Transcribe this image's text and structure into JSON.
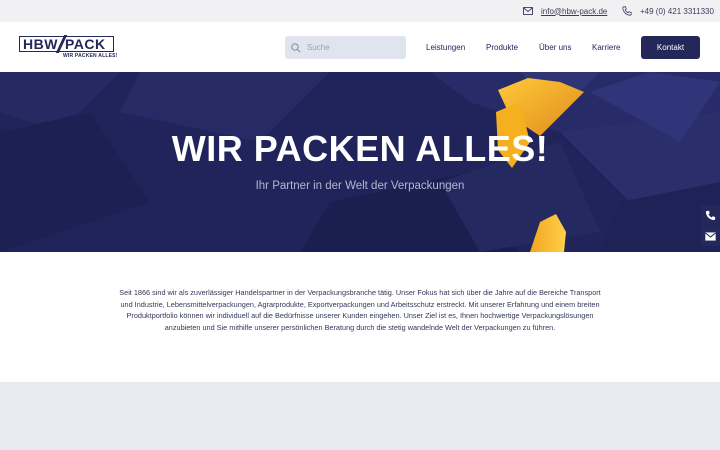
{
  "topbar": {
    "email": "info@hbw-pack.de",
    "phone": "+49 (0) 421 3311330"
  },
  "logo": {
    "brand_left": "HBW",
    "brand_right": "PACK",
    "tagline": "WIR PACKEN ALLES!"
  },
  "search": {
    "placeholder": "Suche"
  },
  "nav": {
    "items": [
      {
        "label": "Leistungen"
      },
      {
        "label": "Produkte"
      },
      {
        "label": "Über uns"
      },
      {
        "label": "Karriere"
      }
    ],
    "cta_label": "Kontakt"
  },
  "hero": {
    "title": "WIR PACKEN ALLES!",
    "subtitle": "Ihr Partner in der Welt der Verpackungen"
  },
  "intro": {
    "text": "Seit 1866 sind wir als zuverlässiger Handelspartner in der Verpackungsbranche tätig. Unser Fokus hat sich über die Jahre auf die Bereiche Transport und Industrie, Lebensmittelverpackungen, Agrarprodukte, Exportverpackungen und Arbeitsschutz erstreckt. Mit unserer Erfahrung und einem breiten Produktportfolio können wir individuell auf die Bedürfnisse unserer Kunden eingehen. Unser Ziel ist es, Ihnen hochwertige Verpackungslösungen anzubieten und Sie mithilfe unserer persönlichen Beratung durch die stetig wandelnde Welt der Verpackungen zu führen."
  },
  "icons": {
    "mail": "mail-icon",
    "phone": "phone-icon",
    "search": "search-icon",
    "side_phone": "phone-icon",
    "side_mail": "mail-icon"
  },
  "colors": {
    "brand_navy": "#23275a",
    "accent_yellow": "#f7b521",
    "topbar_bg": "#f1f1f3",
    "bottom_band": "#e8eaf2"
  }
}
